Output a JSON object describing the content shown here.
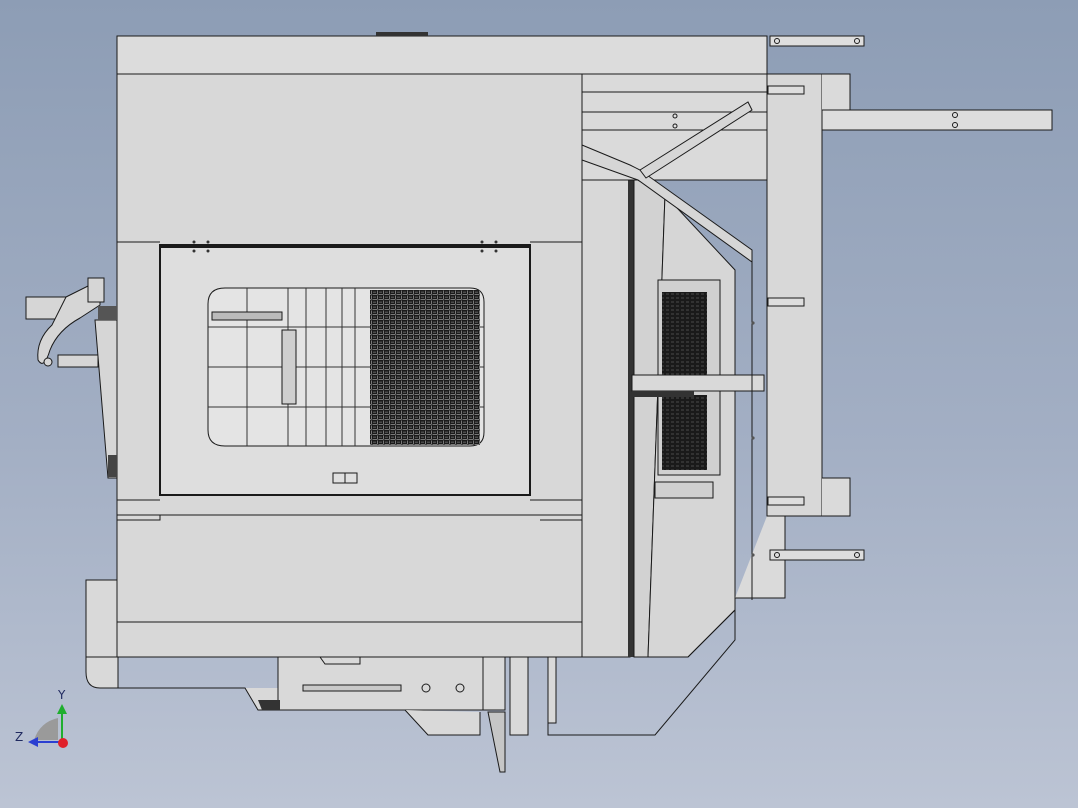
{
  "viewport": {
    "background_top": "#8d9db5",
    "background_bottom": "#bcc4d4"
  },
  "model": {
    "line_color": "#1a1a1a",
    "fill_color": "#d8d8d8",
    "fill_light": "#dcdcdc",
    "grille_color": "#444444"
  },
  "triad": {
    "y_label": "Y",
    "z_label": "Z",
    "y_color": "#1fae2e",
    "z_color": "#2b3fd1",
    "x_color": "#e0202a"
  }
}
